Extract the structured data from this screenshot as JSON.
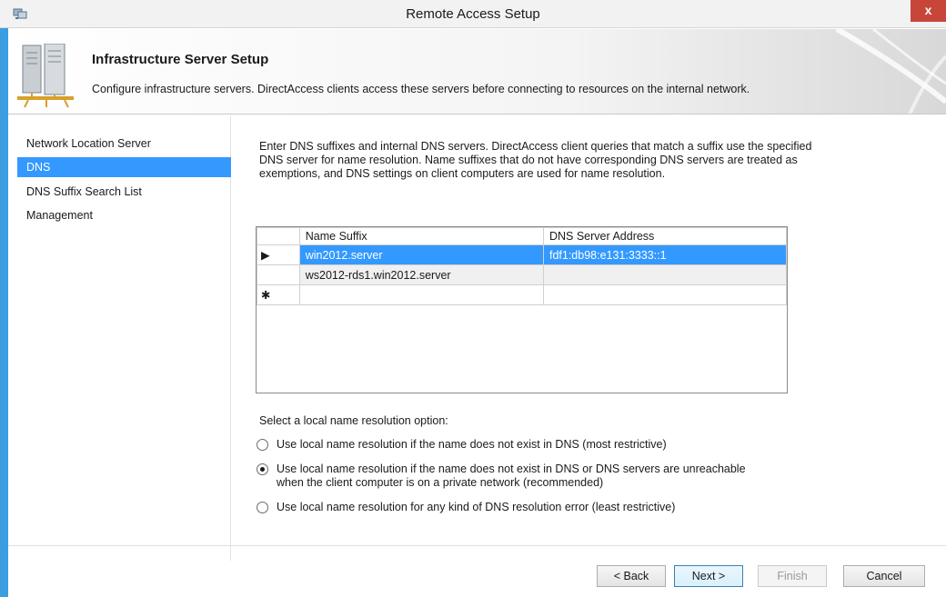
{
  "window": {
    "title": "Remote Access Setup",
    "close_glyph": "x",
    "accent_color": "#3399ff",
    "close_color": "#c8453a"
  },
  "header": {
    "title": "Infrastructure Server Setup",
    "description": "Configure infrastructure servers. DirectAccess clients access these servers before connecting to resources on the internal network.",
    "icon": "server-infrastructure-icon"
  },
  "nav": {
    "items": [
      {
        "label": "Network Location Server",
        "selected": false
      },
      {
        "label": "DNS",
        "selected": true
      },
      {
        "label": "DNS Suffix Search List",
        "selected": false
      },
      {
        "label": "Management",
        "selected": false
      }
    ]
  },
  "main": {
    "intro": "Enter DNS suffixes and internal DNS servers.  DirectAccess client queries that match a suffix use the specified DNS server for name resolution. Name suffixes that do not have corresponding DNS servers are treated as exemptions, and DNS settings on client computers are used for name resolution.",
    "grid": {
      "columns": [
        "Name Suffix",
        "DNS Server Address"
      ],
      "rows": [
        {
          "marker": "▶",
          "name_suffix": "win2012.server",
          "dns_server": "fdf1:db98:e131:3333::1"
        },
        {
          "marker": "",
          "name_suffix": "ws2012-rds1.win2012.server",
          "dns_server": ""
        },
        {
          "marker": "✱",
          "name_suffix": "",
          "dns_server": ""
        }
      ]
    },
    "resolution": {
      "label": "Select a local name resolution option:",
      "options": [
        {
          "text": "Use local name resolution if the name does not exist in DNS (most restrictive)",
          "checked": false
        },
        {
          "text": "Use local name resolution if the name does not exist in DNS or DNS servers are unreachable when the client computer is on a private network (recommended)",
          "checked": true
        },
        {
          "text": "Use local name resolution for any kind of DNS resolution error (least restrictive)",
          "checked": false
        }
      ]
    }
  },
  "footer": {
    "back_label": "< Back",
    "next_label": "Next >",
    "finish_label": "Finish",
    "cancel_label": "Cancel"
  }
}
